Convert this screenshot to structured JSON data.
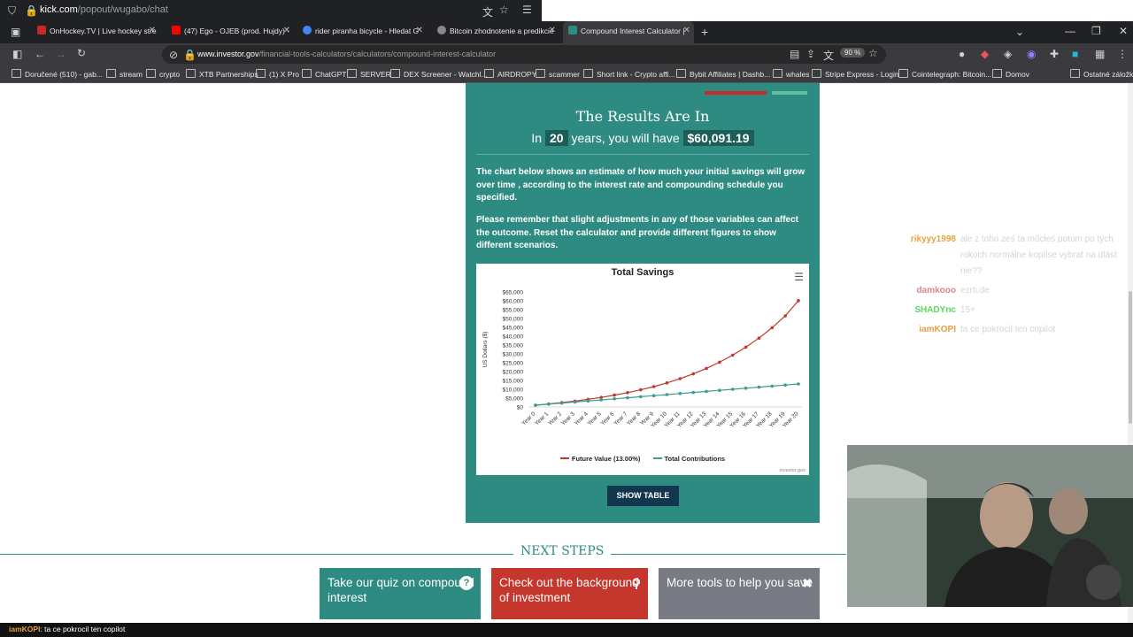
{
  "popout": {
    "url_host": "kick.com",
    "url_path": "/popout/wugabo/chat"
  },
  "tabs": [
    {
      "title": "OnHockey.TV | Live hockey stre",
      "color": "#c62828"
    },
    {
      "title": "(47) Ego - OJEB (prod. Hujdy) -",
      "color": "#ff0000"
    },
    {
      "title": "rider piranha bicycle - Hledat G",
      "color": "#4285f4"
    },
    {
      "title": "Bitcoin zhodnotenie a predikcie",
      "color": "#888888"
    },
    {
      "title": "Compound Interest Calculator |",
      "color": "#2e8b82"
    }
  ],
  "toolbar": {
    "url_host": "www.investor.gov",
    "url_path": "/financial-tools-calculators/calculators/compound-interest-calculator",
    "zoom": "90 %"
  },
  "bookmarks": [
    "Doručené (510) - gab...",
    "stream",
    "crypto",
    "XTB Partnerships",
    "(1) X Pro",
    "ChatGPT",
    "SERVER",
    "DEX Screener - Watchl...",
    "AIRDROPY",
    "scammer",
    "Short link - Crypto affi...",
    "Bybit Affiliates | Dashb...",
    "whales",
    "Stripe Express - Login",
    "Cointelegraph: Bitcoin...",
    "Domov",
    "Ostatné záložky"
  ],
  "results": {
    "heading": "The Results Are In",
    "prefix": "In",
    "years": "20",
    "middle": "years, you will have",
    "amount": "$60,091.19",
    "para1": "The chart below shows an estimate of how much your initial savings will grow over time , according to the interest rate and compounding schedule you specified.",
    "para2": "Please remember that slight adjustments in any of those variables can affect the outcome. Reset the calculator and provide different figures to show different scenarios.",
    "show_table": "SHOW TABLE"
  },
  "chart_data": {
    "type": "line",
    "title": "Total Savings",
    "ylabel": "US Dollars ($)",
    "ylim": [
      0,
      65000
    ],
    "yticks": [
      "$0",
      "$5,000",
      "$10,000",
      "$15,000",
      "$20,000",
      "$25,000",
      "$30,000",
      "$35,000",
      "$40,000",
      "$45,000",
      "$50,000",
      "$55,000",
      "$60,000",
      "$65,000"
    ],
    "categories": [
      "Year 0",
      "Year 1",
      "Year 2",
      "Year 3",
      "Year 4",
      "Year 5",
      "Year 6",
      "Year 7",
      "Year 8",
      "Year 9",
      "Year 10",
      "Year 11",
      "Year 12",
      "Year 13",
      "Year 14",
      "Year 15",
      "Year 16",
      "Year 17",
      "Year 18",
      "Year 19",
      "Year 20"
    ],
    "series": [
      {
        "name": "Future Value (13.00%)",
        "color": "#c0392b",
        "values": [
          1000,
          1700,
          2500,
          3300,
          4300,
          5400,
          6700,
          8100,
          9700,
          11500,
          13600,
          16000,
          18700,
          21800,
          25300,
          29300,
          33800,
          38900,
          44800,
          51500,
          60091
        ]
      },
      {
        "name": "Total Contributions",
        "color": "#3a9d8f",
        "values": [
          1000,
          1600,
          2200,
          2800,
          3400,
          4000,
          4600,
          5200,
          5800,
          6400,
          7000,
          7600,
          8200,
          8800,
          9400,
          10000,
          10600,
          11200,
          11800,
          12400,
          13000
        ]
      }
    ],
    "credit": "investor.gov"
  },
  "next_steps": {
    "label": "NEXT STEPS",
    "cards": [
      {
        "text": "Take our quiz on compound interest",
        "color": "#2e8b82",
        "icon": "?"
      },
      {
        "text": "Check out the background of investment",
        "color": "#c5372c",
        "icon": "search"
      },
      {
        "text": "More tools to help you save",
        "color": "#787b84",
        "icon": "tools"
      }
    ]
  },
  "chat": [
    {
      "user": "rikyyy1998",
      "color": "#e8a33d",
      "text": "ale z toho ześ ta mŭcłeś potom po tých rokoch normálne kopílse vybrat na dlást nie??"
    },
    {
      "user": "damkooo",
      "color": "#d88888",
      "text": "ezrti.de"
    },
    {
      "user": "SHADYnc",
      "color": "#5cd65c",
      "text": "15+"
    },
    {
      "user": "iamKOPI",
      "color": "#e89f3f",
      "text": "ta ce pokrocil ten copilot"
    }
  ],
  "bottom": {
    "user": "iamKOPI",
    "text": ": ta ce pokrocil ten copilot"
  }
}
